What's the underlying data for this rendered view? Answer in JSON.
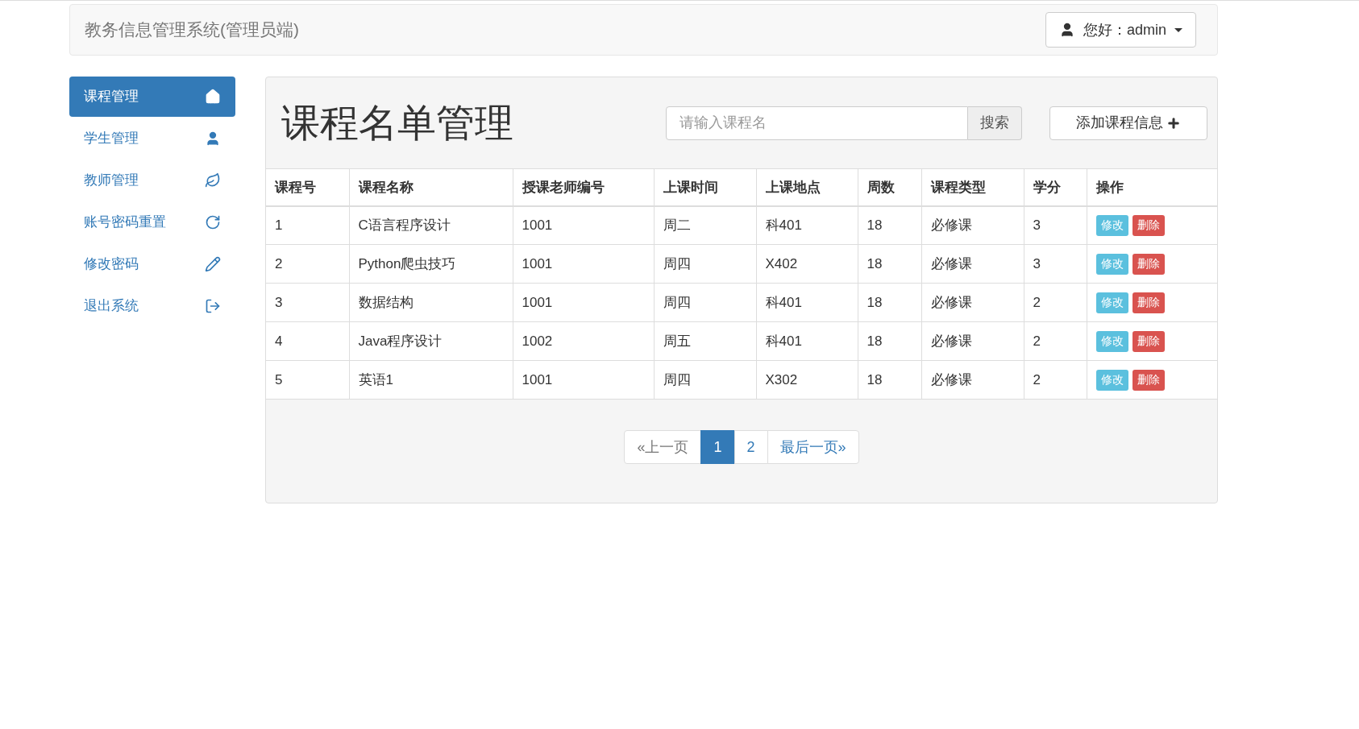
{
  "navbar": {
    "title": "教务信息管理系统(管理员端)",
    "user_menu": "您好：admin"
  },
  "sidebar": {
    "items": [
      {
        "label": "课程管理",
        "kind": "home",
        "selected": true
      },
      {
        "label": "学生管理",
        "kind": "user",
        "selected": false
      },
      {
        "label": "教师管理",
        "kind": "leaf",
        "selected": false
      },
      {
        "label": "账号密码重置",
        "kind": "refresh",
        "selected": false
      },
      {
        "label": "修改密码",
        "kind": "pencil",
        "selected": false
      },
      {
        "label": "退出系统",
        "kind": "logout",
        "selected": false
      }
    ]
  },
  "panel": {
    "title": "课程名单管理",
    "search": {
      "placeholder": "请输入课程名",
      "button": "搜索"
    },
    "add_button": "添加课程信息"
  },
  "table": {
    "columns": [
      "课程号",
      "课程名称",
      "授课老师编号",
      "上课时间",
      "上课地点",
      "周数",
      "课程类型",
      "学分",
      "操作"
    ],
    "rows": [
      {
        "cells": [
          "1",
          "C语言程序设计",
          "1001",
          "周二",
          "科401",
          "18",
          "必修课",
          "3"
        ],
        "actions": [
          "修改",
          "删除"
        ]
      },
      {
        "cells": [
          "2",
          "Python爬虫技巧",
          "1001",
          "周四",
          "X402",
          "18",
          "必修课",
          "3"
        ],
        "actions": [
          "修改",
          "删除"
        ]
      },
      {
        "cells": [
          "3",
          "数据结构",
          "1001",
          "周四",
          "科401",
          "18",
          "必修课",
          "2"
        ],
        "actions": [
          "修改",
          "删除"
        ]
      },
      {
        "cells": [
          "4",
          "Java程序设计",
          "1002",
          "周五",
          "科401",
          "18",
          "必修课",
          "2"
        ],
        "actions": [
          "修改",
          "删除"
        ]
      },
      {
        "cells": [
          "5",
          "英语1",
          "1001",
          "周四",
          "X302",
          "18",
          "必修课",
          "2"
        ],
        "actions": [
          "修改",
          "删除"
        ]
      }
    ]
  },
  "pagination": [
    {
      "label": "«上一页",
      "selected": false,
      "disabled": true
    },
    {
      "label": "1",
      "selected": true,
      "disabled": false
    },
    {
      "label": "2",
      "selected": false,
      "disabled": false
    },
    {
      "label": "最后一页»",
      "selected": false,
      "disabled": false
    }
  ]
}
